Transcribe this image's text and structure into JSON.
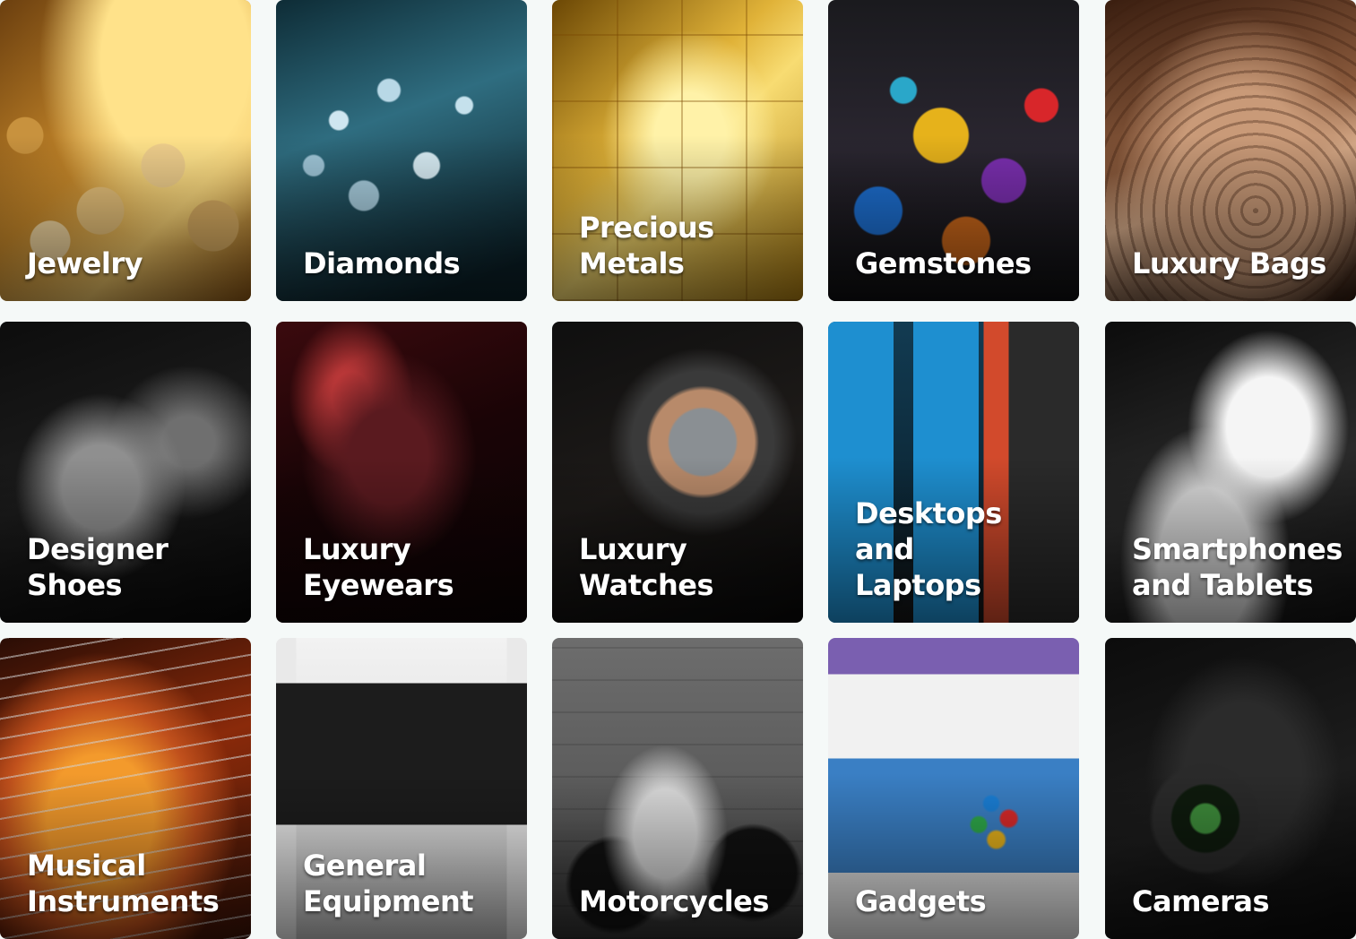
{
  "categories": [
    {
      "title": [
        "Jewelry"
      ],
      "icon": "jewelry-photo"
    },
    {
      "title": [
        "Diamonds"
      ],
      "icon": "diamonds-photo"
    },
    {
      "title": [
        "Precious",
        "Metals"
      ],
      "icon": "gold-bars-photo"
    },
    {
      "title": [
        "Gemstones"
      ],
      "icon": "gemstones-photo"
    },
    {
      "title": [
        "Luxury Bags"
      ],
      "icon": "handbag-photo"
    },
    {
      "title": [
        "Designer",
        "Shoes"
      ],
      "icon": "high-heel-photo"
    },
    {
      "title": [
        "Luxury",
        "Eyewears"
      ],
      "icon": "sunglasses-photo"
    },
    {
      "title": [
        "Luxury",
        "Watches"
      ],
      "icon": "wristwatch-photo"
    },
    {
      "title": [
        "Desktops and",
        "Laptops"
      ],
      "icon": "laptop-photo"
    },
    {
      "title": [
        "Smartphones",
        "and Tablets"
      ],
      "icon": "smartphone-photo"
    },
    {
      "title": [
        "Musical",
        "Instruments"
      ],
      "icon": "guitar-photo"
    },
    {
      "title": [
        "General",
        "Equipment"
      ],
      "icon": "television-photo"
    },
    {
      "title": [
        "Motorcycles"
      ],
      "icon": "motorcycle-photo"
    },
    {
      "title": [
        "Gadgets"
      ],
      "icon": "game-console-photo"
    },
    {
      "title": [
        "Cameras"
      ],
      "icon": "camera-photo"
    }
  ],
  "colors": {
    "page_background": "#f5f9f8",
    "label_text": "#ffffff"
  }
}
